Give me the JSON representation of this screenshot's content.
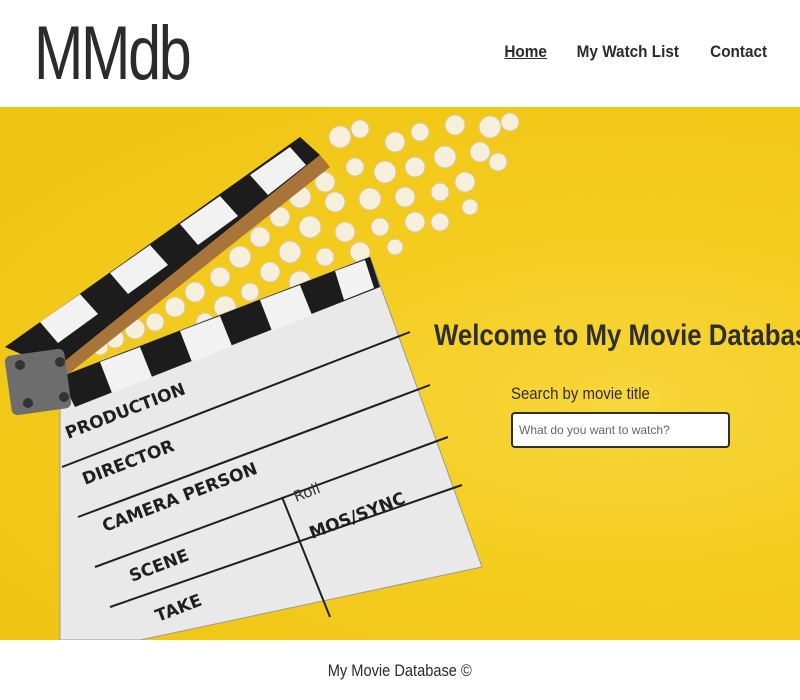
{
  "header": {
    "logo": "MMdb",
    "nav": [
      {
        "label": "Home",
        "active": true
      },
      {
        "label": "My Watch List",
        "active": false
      },
      {
        "label": "Contact",
        "active": false
      }
    ]
  },
  "hero": {
    "image_description_icons": [
      "clapperboard-icon",
      "popcorn-icon"
    ],
    "clapper_text": {
      "production": "PRODUCTION",
      "director": "DIRECTOR",
      "camera": "CAMERA PERSON",
      "scene": "SCENE",
      "take": "TAKE",
      "roll": "Roll",
      "mos": "MOS/SYNC"
    },
    "welcome": "Welcome to My Movie Database",
    "search": {
      "label": "Search by movie title",
      "placeholder": "What do you want to watch?",
      "value": ""
    }
  },
  "footer": {
    "text": "My Movie Database ©"
  },
  "colors": {
    "hero_yellow": "#f4cc1e",
    "text_dark": "#2b2b2b"
  }
}
